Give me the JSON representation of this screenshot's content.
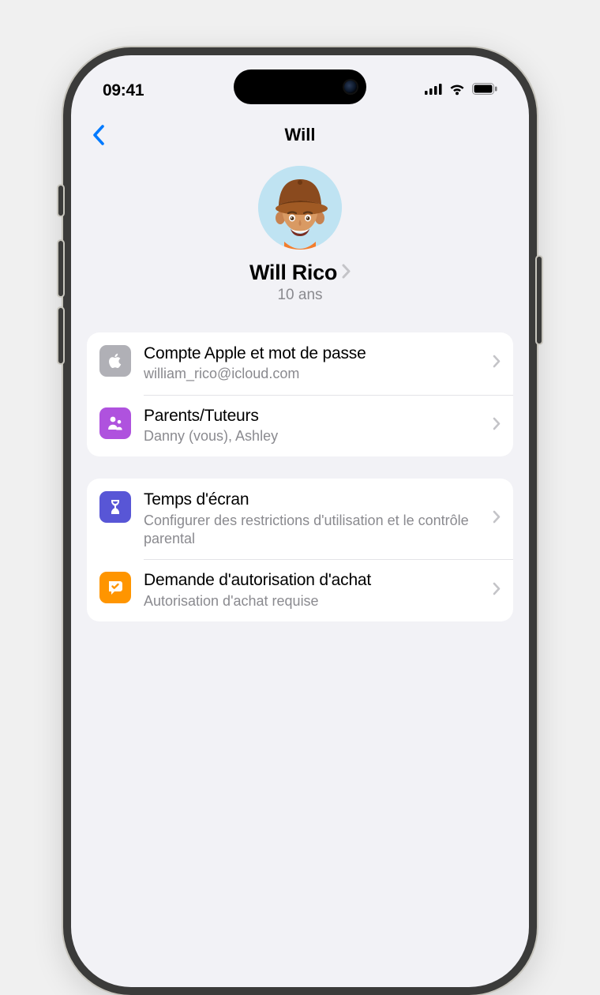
{
  "statusbar": {
    "time": "09:41"
  },
  "nav": {
    "title": "Will"
  },
  "profile": {
    "name": "Will Rico",
    "age": "10 ans"
  },
  "groups": [
    {
      "rows": [
        {
          "icon": "apple",
          "title": "Compte Apple et mot de passe",
          "subtitle": "william_rico@icloud.com"
        },
        {
          "icon": "parents",
          "title": "Parents/Tuteurs",
          "subtitle": "Danny (vous), Ashley"
        }
      ]
    },
    {
      "rows": [
        {
          "icon": "hourglass",
          "title": "Temps d'écran",
          "subtitle": "Configurer des restrictions d'utilisation et le contrôle parental"
        },
        {
          "icon": "ask",
          "title": "Demande d'autorisation d'achat",
          "subtitle": "Autorisation d'achat requise"
        }
      ]
    }
  ]
}
